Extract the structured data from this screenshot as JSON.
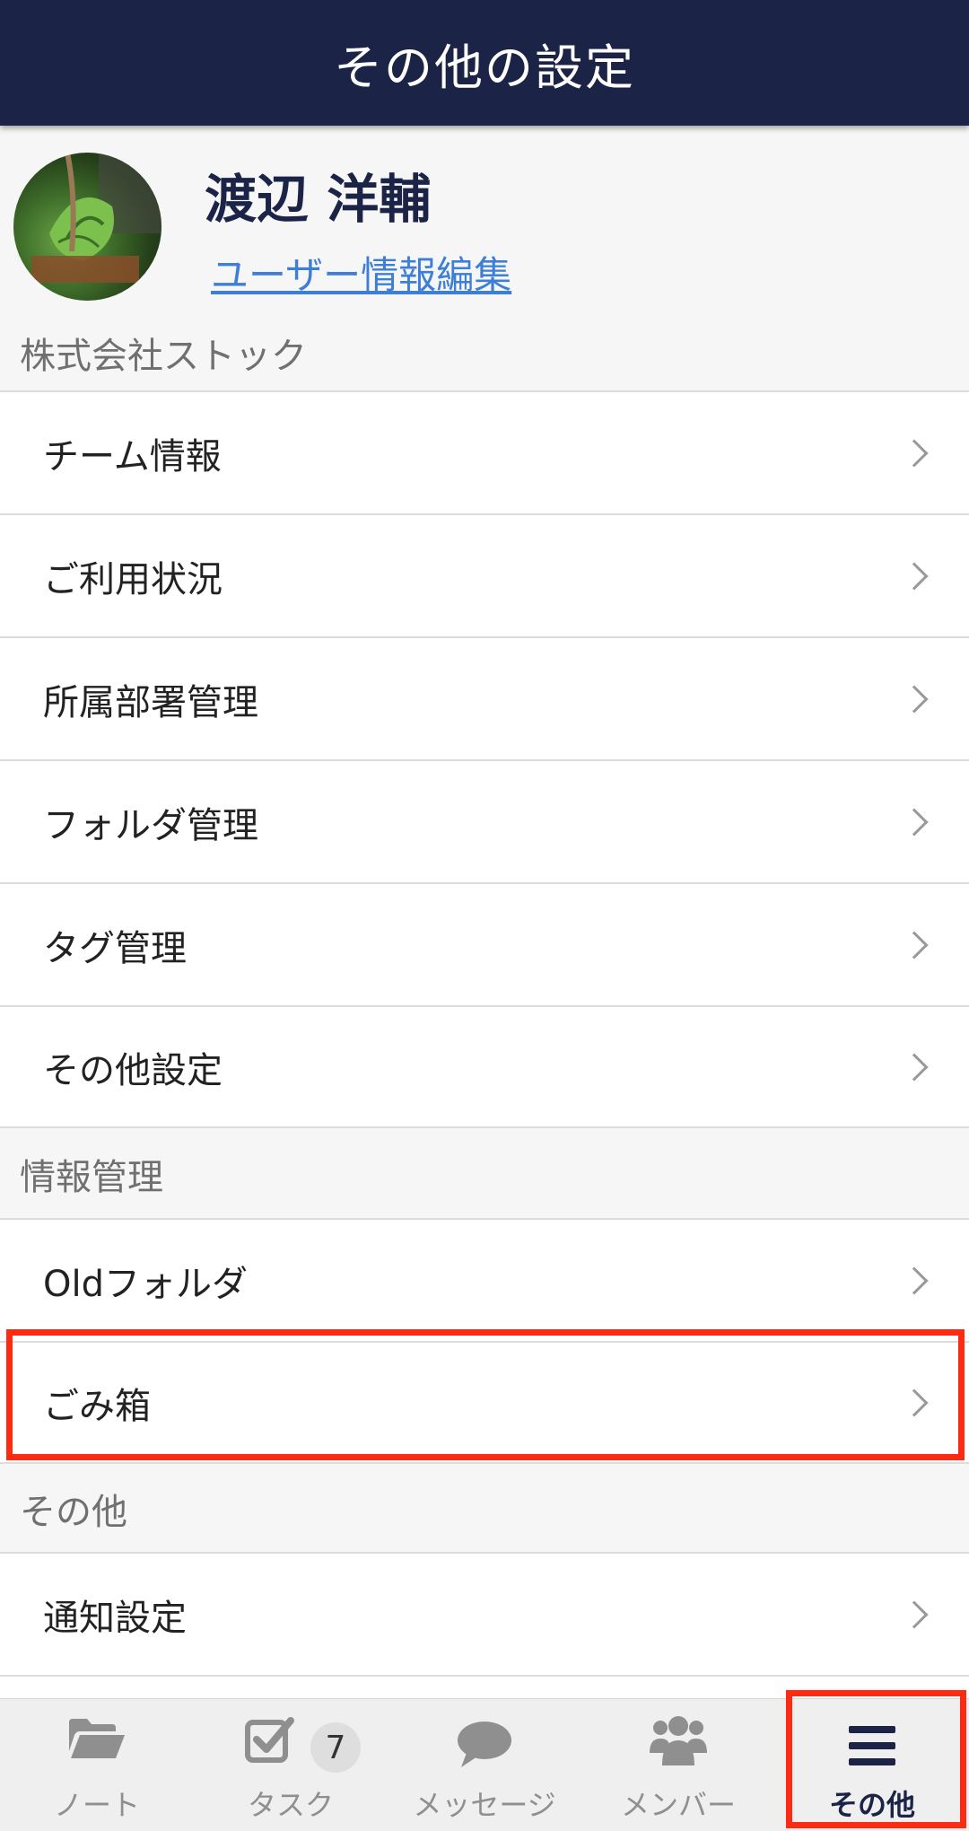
{
  "header": {
    "title": "その他の設定"
  },
  "profile": {
    "name": "渡辺 洋輔",
    "edit_link": "ユーザー情報編集"
  },
  "sections": {
    "company": "株式会社ストック",
    "info": "情報管理",
    "other": "その他"
  },
  "company_items": [
    {
      "label": "チーム情報"
    },
    {
      "label": "ご利用状況"
    },
    {
      "label": "所属部署管理"
    },
    {
      "label": "フォルダ管理"
    },
    {
      "label": "タグ管理"
    },
    {
      "label": "その他設定"
    }
  ],
  "info_items": [
    {
      "label": "Oldフォルダ"
    },
    {
      "label": "ごみ箱"
    }
  ],
  "other_items": [
    {
      "label": "通知設定"
    }
  ],
  "tabbar": {
    "tabs": [
      {
        "label": "ノート",
        "icon": "folder-icon"
      },
      {
        "label": "タスク",
        "icon": "task-check-icon",
        "badge": "7"
      },
      {
        "label": "メッセージ",
        "icon": "chat-bubble-icon"
      },
      {
        "label": "メンバー",
        "icon": "members-icon"
      },
      {
        "label": "その他",
        "icon": "menu-icon",
        "active": true
      }
    ]
  },
  "colors": {
    "header_bg": "#1b2446",
    "link": "#3d7fd6",
    "highlight": "#ff2a12",
    "active_tab": "#1b2446"
  }
}
